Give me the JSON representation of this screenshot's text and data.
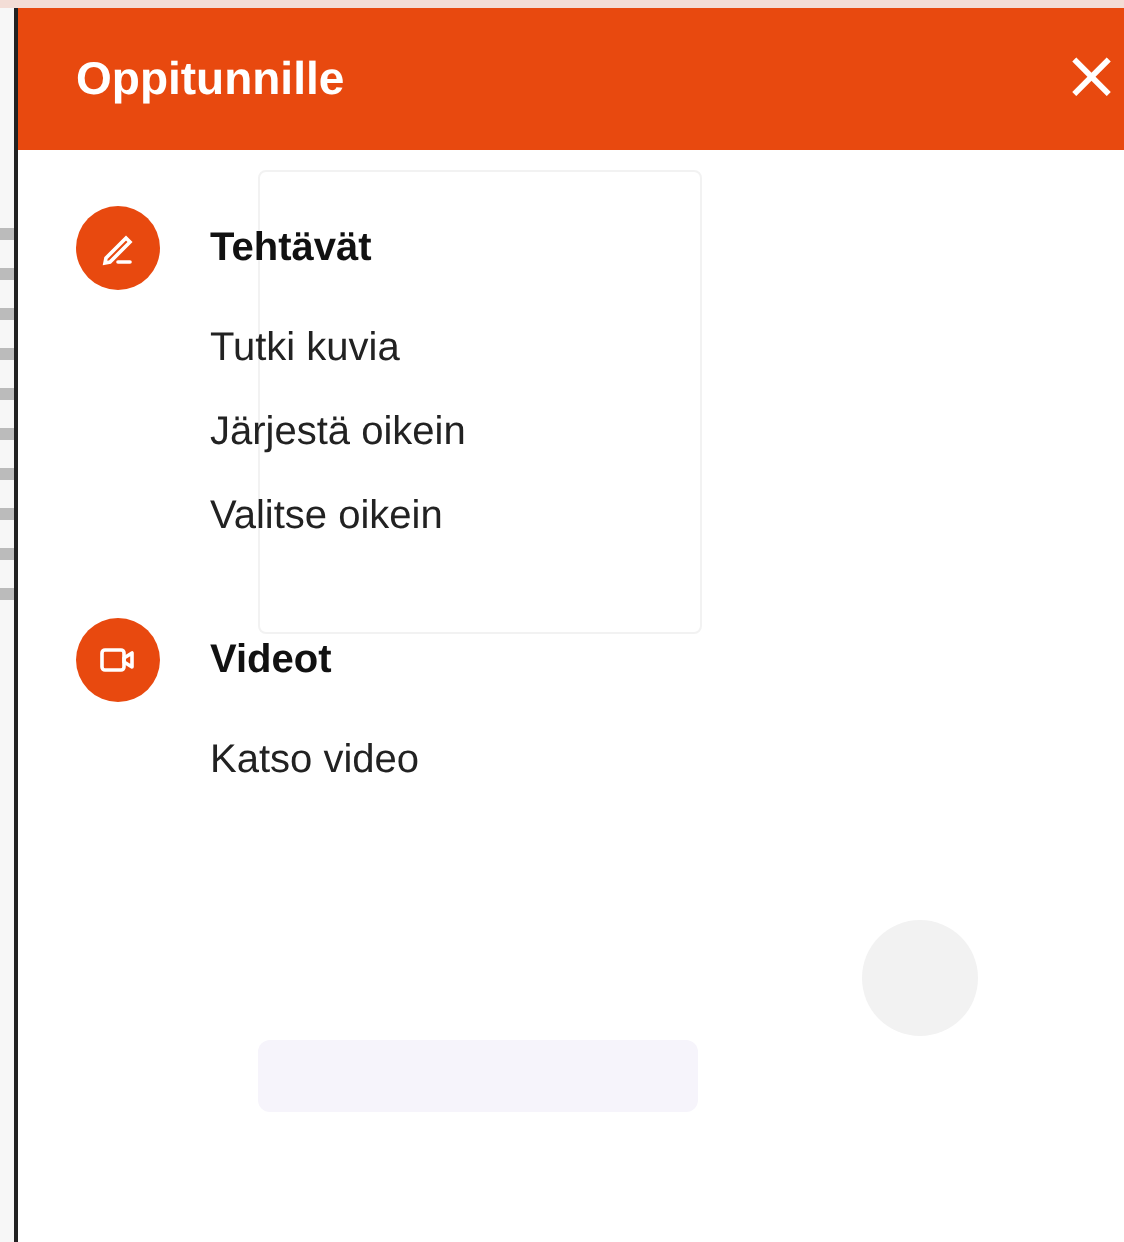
{
  "panel": {
    "title": "Oppitunnille",
    "close": "×"
  },
  "groups": [
    {
      "kind": "tasks",
      "heading": "Tehtävät",
      "items": [
        "Tutki kuvia",
        "Järjestä oikein",
        "Valitse oikein"
      ]
    },
    {
      "kind": "video",
      "heading": "Videot",
      "items": [
        "Katso video"
      ]
    }
  ]
}
